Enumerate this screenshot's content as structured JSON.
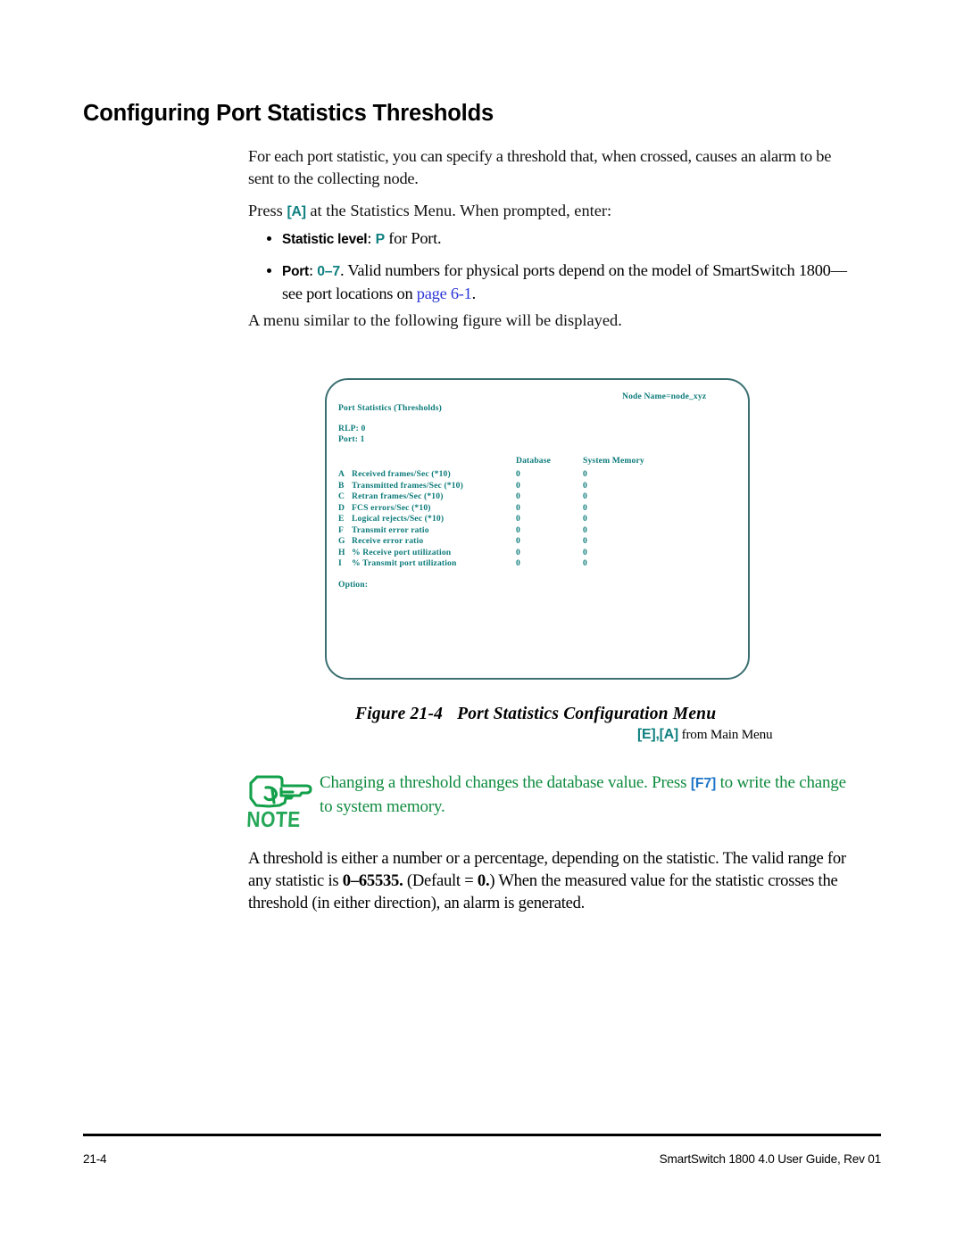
{
  "page": {
    "heading": "Configuring Port Statistics Thresholds"
  },
  "intro": {
    "paragraph1": "For each port statistic, you can specify a threshold that, when crossed, causes an alarm to be sent to the collecting node.",
    "press_prefix": "Press ",
    "press_key": "[A]",
    "press_suffix": " at the Statistics Menu. When prompted, enter:"
  },
  "bullets": [
    {
      "label": "Statistic level",
      "separator": ": ",
      "key": "P",
      "rest": " for Port."
    },
    {
      "label": "Port",
      "separator": ": ",
      "key": "0–7",
      "rest": ". Valid numbers for physical ports depend on the model of SmartSwitch 1800—see port locations on ",
      "link": "page 6-1",
      "tail": "."
    }
  ],
  "after_bullets": "A menu similar to the following figure will be displayed.",
  "terminal": {
    "node_name": "Node Name=node_xyz",
    "title": "Port Statistics (Thresholds)",
    "rlp": "RLP: 0",
    "port": "Port: 1",
    "columns": [
      "Database",
      "System Memory"
    ],
    "rows": [
      {
        "key": "A",
        "label": "Received frames/Sec (*10)",
        "database": "0",
        "system_memory": "0"
      },
      {
        "key": "B",
        "label": "Transmitted frames/Sec (*10)",
        "database": "0",
        "system_memory": "0"
      },
      {
        "key": "C",
        "label": "Retran frames/Sec (*10)",
        "database": "0",
        "system_memory": "0"
      },
      {
        "key": "D",
        "label": "FCS errors/Sec (*10)",
        "database": "0",
        "system_memory": "0"
      },
      {
        "key": "E",
        "label": "Logical rejects/Sec (*10)",
        "database": "0",
        "system_memory": "0"
      },
      {
        "key": "F",
        "label": "Transmit error ratio",
        "database": "0",
        "system_memory": "0"
      },
      {
        "key": "G",
        "label": "Receive error ratio",
        "database": "0",
        "system_memory": "0"
      },
      {
        "key": "H",
        "label": "% Receive port utilization",
        "database": "0",
        "system_memory": "0"
      },
      {
        "key": "I",
        "label": "% Transmit port utilization",
        "database": "0",
        "system_memory": "0"
      }
    ],
    "option_prompt": "Option:"
  },
  "figure": {
    "number": "Figure 21-4",
    "title": "Port Statistics Configuration Menu",
    "source_keys": "[E],[A]",
    "source_text": " from Main Menu"
  },
  "note": {
    "icon_word": "NOTE",
    "text_before": "Changing a threshold changes the database value. Press ",
    "key": "[F7]",
    "text_after": " to write the change to system memory."
  },
  "closing": {
    "part1": "A threshold is either a number or a percentage, depending on the statistic. The valid range for any statistic is ",
    "range": "0–65535.",
    "part2": " (Default = ",
    "default": "0.",
    "part3": ") When the measured value for the statistic crosses the threshold (in either direction), an alarm is generated."
  },
  "footer": {
    "page_number": "21-4",
    "doc_title": "SmartSwitch 1800 4.0 User Guide, Rev 01"
  },
  "colors": {
    "accent_teal": "#0f8080",
    "terminal_teal": "#0e7b7b",
    "terminal_border": "#3b6f72",
    "link_blue": "#2b36d8",
    "note_green": "#0f8b3f",
    "note_icon_green": "#13a04a"
  }
}
